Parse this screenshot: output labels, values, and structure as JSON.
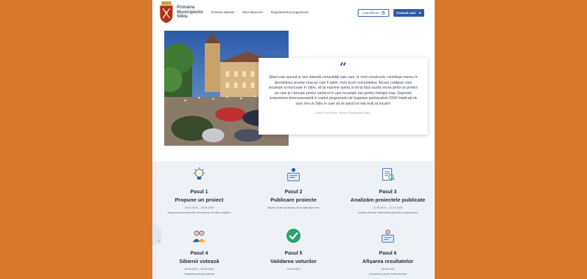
{
  "header": {
    "logo_lines": [
      "Primăria",
      "Municipiului",
      "Sibiu"
    ],
    "nav": [
      "Proiecte depuse",
      "Ghid depunere",
      "Regulamentul programului"
    ],
    "auth_label": "Autentificare",
    "create_label": "Creează cont"
  },
  "quote": {
    "mark": "“",
    "text": "Sibiul este special și unic datorită comunității sale care, în mod constructiv, contribuie mereu în dezvoltarea acestui oraș pe care îl iubim. Invit acum comunitatea, fiecare cetățean care locuiește și muncește în Sibiu, să își exprime opinia și să își facă auzită vocea printr-un proiect pe care și-l dorește pentru cartierul în care locuiește sau pentru întregul oraș. Depuneți propunerea dumneavoastră în cadrul programului de bugetare participativă 2024! Implicați-vă activ într-un Sibiu în care să ne placă tot mai mult să locuim!",
    "author": "— Astrid Cora Fodor, Primarul Municipiului Sibiu —"
  },
  "steps": [
    {
      "num": "Pasul 1",
      "title": "Propune un proiect",
      "date": "16.05.2024 – 16.06.2024",
      "desc": "Depunerea propunerilor de proiecte de către cetățeni",
      "icon": "lightbulb-icon"
    },
    {
      "num": "Pasul 2",
      "title": "Publicare proiecte",
      "date": "",
      "desc": "Maxim 5 zile lucrătoare de la data depunerii",
      "icon": "presenter-icon"
    },
    {
      "num": "Pasul 3",
      "title": "Analizăm proiectele publicate",
      "date": "11.06.2024 – 31.07.2024",
      "desc": "Analiza tehnică, financiară și juridică a propunerilor",
      "icon": "document-analysis-icon"
    },
    {
      "num": "Pasul 4",
      "title": "Sibienii votează",
      "date": "01.08.2024 – 16.08.2024",
      "desc": "Votează proiectul preferat",
      "icon": "voters-icon"
    },
    {
      "num": "Pasul 5",
      "title": "Validarea voturilor",
      "date": "23.08.2024",
      "desc": "",
      "icon": "check-circle-icon"
    },
    {
      "num": "Pasul 6",
      "title": "Afișarea rezultatelor",
      "date": "30.08.2024",
      "desc": "10 proiecte pentru implementare",
      "icon": "results-icon"
    }
  ],
  "colors": {
    "accent": "#2e5aa8",
    "background": "#d9782a",
    "steps_bg": "#eef2f7",
    "check": "#2aa56b"
  }
}
